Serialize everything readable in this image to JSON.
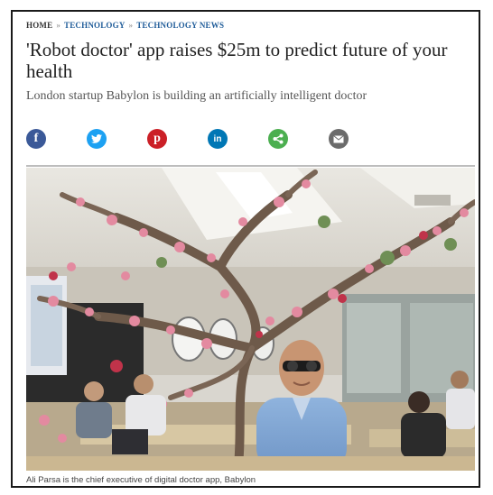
{
  "breadcrumb": {
    "home": "HOME",
    "sep": "»",
    "section": "TECHNOLOGY",
    "subsection": "TECHNOLOGY NEWS"
  },
  "article": {
    "headline": "'Robot doctor' app raises $25m to predict future of your health",
    "standfirst": "London startup Babylon is building an artificially intelligent doctor",
    "caption": "Ali Parsa is the chief executive of digital doctor app, Babylon"
  },
  "share": [
    {
      "icon": "facebook-icon",
      "color": "#3b5998",
      "glyph": "f"
    },
    {
      "icon": "twitter-icon",
      "color": "#1da1f2",
      "glyph": "t"
    },
    {
      "icon": "pinterest-icon",
      "color": "#cb2027",
      "glyph": "p"
    },
    {
      "icon": "linkedin-icon",
      "color": "#0077b5",
      "glyph": "in"
    },
    {
      "icon": "share-icon",
      "color": "#4caf50",
      "glyph": "<"
    },
    {
      "icon": "email-icon",
      "color": "#6b6b6b",
      "glyph": "✉"
    }
  ]
}
